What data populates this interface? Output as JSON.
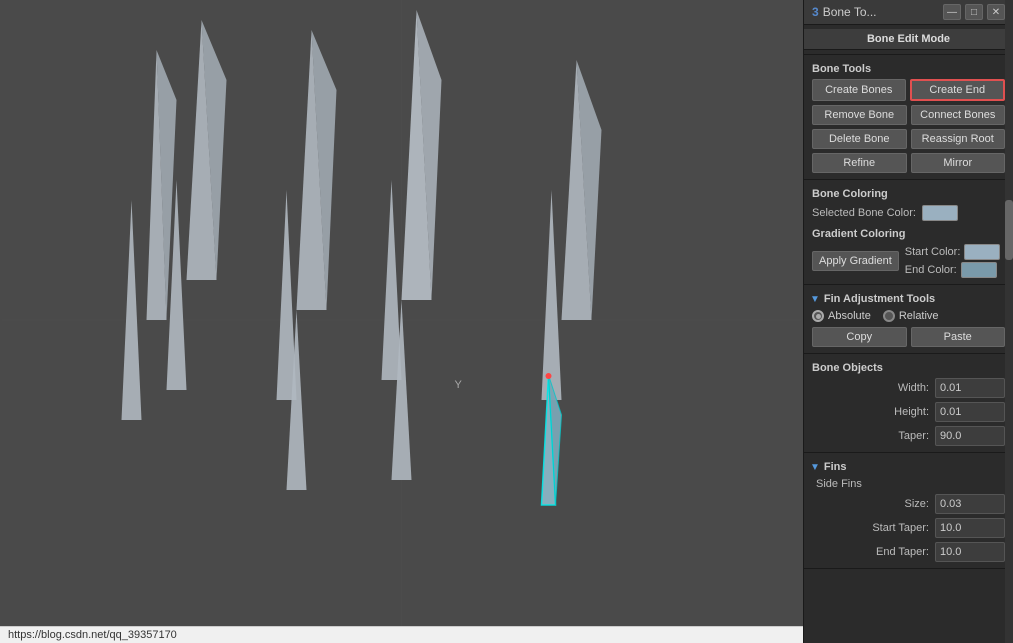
{
  "window": {
    "title": "Bone To...",
    "url": "https://blog.csdn.net/qq_39357170"
  },
  "panel": {
    "bone_edit_mode_label": "Bone Edit Mode",
    "bone_tools_label": "Bone Tools",
    "create_bones_label": "Create Bones",
    "create_end_label": "Create End",
    "remove_bone_label": "Remove Bone",
    "connect_bones_label": "Connect Bones",
    "delete_bone_label": "Delete Bone",
    "reassign_root_label": "Reassign Root",
    "refine_label": "Refine",
    "mirror_label": "Mirror",
    "bone_coloring_label": "Bone Coloring",
    "selected_bone_color_label": "Selected Bone Color:",
    "gradient_coloring_label": "Gradient Coloring",
    "apply_gradient_label": "Apply Gradient",
    "start_color_label": "Start Color:",
    "end_color_label": "End Color:",
    "fin_adjustment_label": "Fin Adjustment Tools",
    "absolute_label": "Absolute",
    "relative_label": "Relative",
    "copy_label": "Copy",
    "paste_label": "Paste",
    "bone_objects_label": "Bone Objects",
    "width_label": "Width:",
    "height_label": "Height:",
    "taper_label": "Taper:",
    "width_value": "0.01",
    "height_value": "0.01",
    "taper_value": "90.0",
    "fins_label": "Fins",
    "side_fins_label": "Side Fins",
    "size_label": "Size:",
    "start_taper_label": "Start Taper:",
    "end_taper_label": "End Taper:",
    "size_value": "0.03",
    "start_taper_value": "10.0",
    "end_taper_value": "10.0"
  }
}
